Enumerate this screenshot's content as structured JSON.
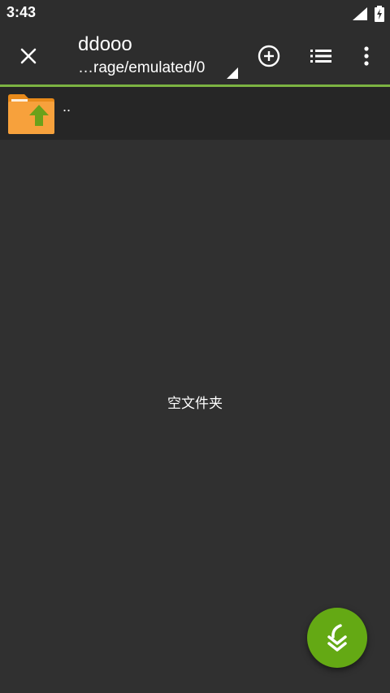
{
  "status_bar": {
    "time": "3:43",
    "icons": [
      "signal-icon",
      "battery-charging-icon"
    ]
  },
  "toolbar": {
    "title": "ddooo",
    "path": "…rage/emulated/0",
    "icons": [
      "close-icon",
      "add-circle-icon",
      "list-view-icon",
      "more-vert-icon"
    ]
  },
  "file_list": {
    "items": [
      {
        "name": "..",
        "icon": "folder-up-icon"
      }
    ],
    "empty_message": "空文件夹"
  },
  "fab": {
    "icon": "download-arrow-icon"
  },
  "colors": {
    "background": "#303030",
    "toolbar": "#2d2d2d",
    "accent": "#7cb342",
    "fab": "#64a914",
    "folder": "#f7a13c"
  }
}
